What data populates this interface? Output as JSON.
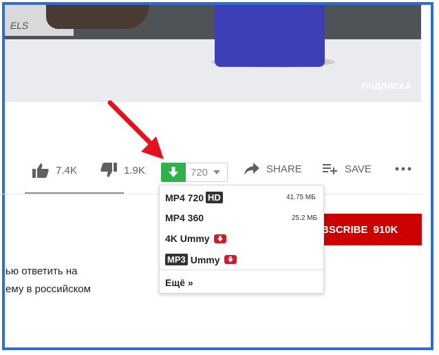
{
  "video": {
    "watermark": "ПОДПИСКА",
    "shirt_text": "ELS"
  },
  "actions": {
    "like_count": "7.4K",
    "dislike_count": "1.9K",
    "share_label": "SHARE",
    "save_label": "SAVE"
  },
  "downloader": {
    "selected_quality": "720",
    "accent_color": "#2fb24a",
    "menu": {
      "items": [
        {
          "label": "MP4 720",
          "badge": "HD",
          "size": "41.75 МБ"
        },
        {
          "label": "MP4 360",
          "size": "25.2 МБ"
        },
        {
          "label": "4K Ummy"
        },
        {
          "badge": "MP3",
          "label": "Ummy"
        }
      ],
      "more_label": "Ещё »"
    }
  },
  "subscribe": {
    "label": "BSCRIBE",
    "count": "910K",
    "color": "#cc0000"
  },
  "description": {
    "line1": "ью ответить на",
    "line2": "ему в российском"
  },
  "icons": [
    "thumbs-up-icon",
    "thumbs-down-icon",
    "download-arrow-icon",
    "caret-down-icon",
    "share-icon",
    "playlist-add-icon",
    "more-dots-icon",
    "ummy-download-icon",
    "red-pointer-arrow"
  ]
}
